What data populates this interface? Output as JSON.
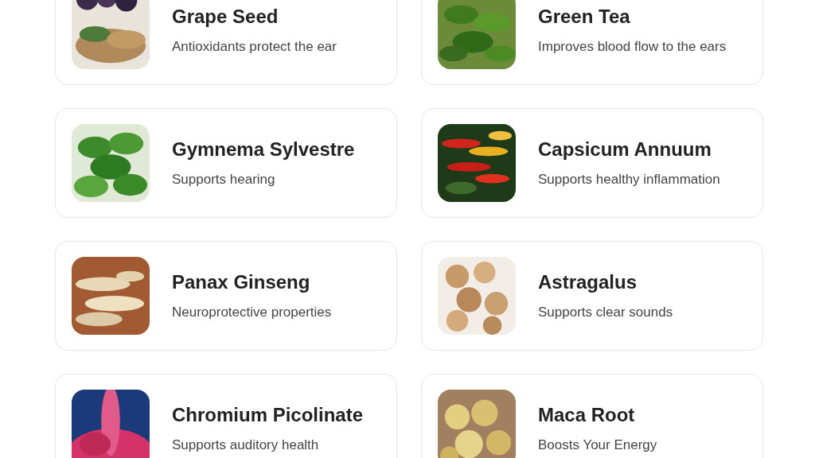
{
  "ingredients": [
    {
      "title": "Grape Seed",
      "description": "Antioxidants protect the ear"
    },
    {
      "title": "Green Tea",
      "description": "Improves blood flow to the ears"
    },
    {
      "title": "Gymnema Sylvestre",
      "description": "Supports hearing"
    },
    {
      "title": "Capsicum Annuum",
      "description": "Supports healthy inflammation"
    },
    {
      "title": "Panax Ginseng",
      "description": "Neuroprotective properties"
    },
    {
      "title": "Astragalus",
      "description": "Supports clear sounds"
    },
    {
      "title": "Chromium Picolinate",
      "description": "Supports auditory health"
    },
    {
      "title": "Maca Root",
      "description": "Boosts Your Energy"
    }
  ]
}
